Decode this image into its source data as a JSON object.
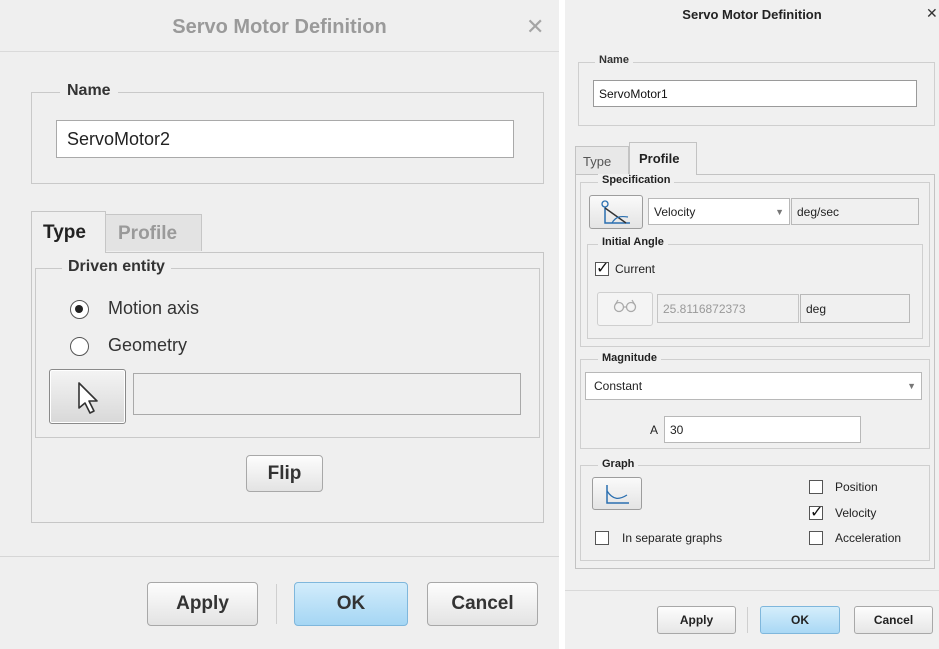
{
  "left_dialog": {
    "title": "Servo Motor Definition",
    "close": "✕",
    "name_legend": "Name",
    "name_value": "ServoMotor2",
    "tabs": {
      "type": "Type",
      "profile": "Profile"
    },
    "driven_entity": {
      "legend": "Driven entity",
      "options": [
        "Motion axis",
        "Geometry"
      ],
      "selected": "Motion axis"
    },
    "flip_label": "Flip",
    "buttons": {
      "apply": "Apply",
      "ok": "OK",
      "cancel": "Cancel"
    }
  },
  "right_dialog": {
    "title": "Servo Motor Definition",
    "close": "✕",
    "name_legend": "Name",
    "name_value": "ServoMotor1",
    "tabs": {
      "type": "Type",
      "profile": "Profile"
    },
    "specification": {
      "legend": "Specification",
      "selected": "Velocity",
      "unit": "deg/sec"
    },
    "initial_angle": {
      "legend": "Initial Angle",
      "current_label": "Current",
      "current_checked": true,
      "value": "25.8116872373",
      "unit": "deg"
    },
    "magnitude": {
      "legend": "Magnitude",
      "selected": "Constant",
      "a_label": "A",
      "a_value": "30"
    },
    "graph": {
      "legend": "Graph",
      "separate_label": "In separate graphs",
      "separate_checked": false,
      "position_label": "Position",
      "position_checked": false,
      "velocity_label": "Velocity",
      "velocity_checked": true,
      "acceleration_label": "Acceleration",
      "acceleration_checked": false
    },
    "buttons": {
      "apply": "Apply",
      "ok": "OK",
      "cancel": "Cancel"
    }
  }
}
